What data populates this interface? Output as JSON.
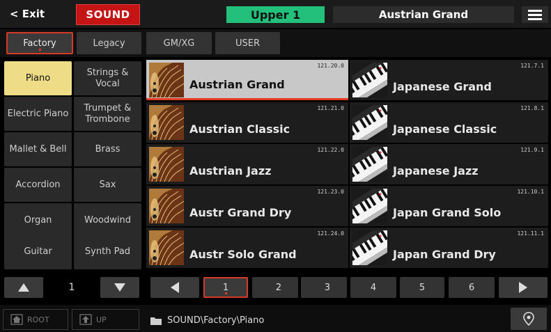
{
  "header": {
    "exit_label": "< Exit",
    "mode_label": "SOUND",
    "keyboard_part": "Upper 1",
    "current_sound": "Austrian Grand",
    "menu_icon": "hamburger-menu-icon"
  },
  "banks": {
    "factory": "Factory",
    "legacy": "Legacy",
    "gmxg": "GM/XG",
    "user": "USER"
  },
  "categories": [
    "Piano",
    "Strings & Vocal",
    "Electric Piano",
    "Trumpet & Trombone",
    "Mallet & Bell",
    "Brass",
    "Accordion",
    "Sax",
    "Organ",
    "Woodwind",
    "Guitar",
    "Synth Pad"
  ],
  "category_page": "1",
  "sounds": [
    {
      "name": "Austrian Grand",
      "number": "121.20.0",
      "icon": "grand-piano-icon"
    },
    {
      "name": "Japanese Grand",
      "number": "121.7.1",
      "icon": "piano-keys-icon"
    },
    {
      "name": "Austrian Classic",
      "number": "121.21.0",
      "icon": "grand-piano-icon"
    },
    {
      "name": "Japanese Classic",
      "number": "121.8.1",
      "icon": "piano-keys-icon"
    },
    {
      "name": "Austrian Jazz",
      "number": "121.22.0",
      "icon": "grand-piano-icon"
    },
    {
      "name": "Japanese Jazz",
      "number": "121.9.1",
      "icon": "piano-keys-icon"
    },
    {
      "name": "Austr Grand Dry",
      "number": "121.23.0",
      "icon": "grand-piano-icon"
    },
    {
      "name": "Japan Grand Solo",
      "number": "121.10.1",
      "icon": "piano-keys-icon"
    },
    {
      "name": "Austr Solo Grand",
      "number": "121.24.0",
      "icon": "grand-piano-icon"
    },
    {
      "name": "Japan Grand Dry",
      "number": "121.11.1",
      "icon": "piano-keys-icon"
    }
  ],
  "pages": [
    "1",
    "2",
    "3",
    "4",
    "5",
    "6"
  ],
  "footer": {
    "root_label": "ROOT",
    "up_label": "UP",
    "path": "SOUND\\Factory\\Piano"
  },
  "colors": {
    "accent_red": "#c41414",
    "part_green": "#22c07a",
    "selected_category": "#efdc86",
    "selection_border": "#d43a26"
  }
}
